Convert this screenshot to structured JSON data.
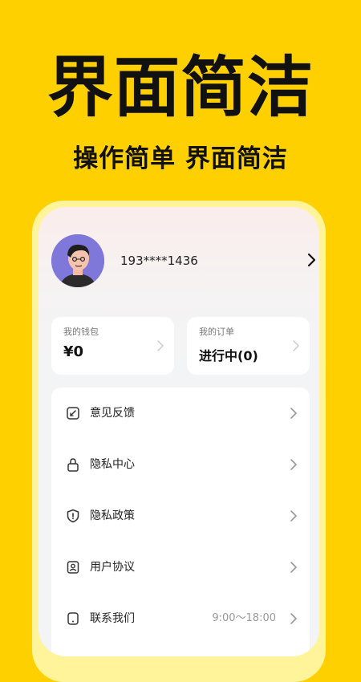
{
  "promo": {
    "title": "界面简洁",
    "subtitle": "操作简单 界面简洁"
  },
  "profile": {
    "phone": "193****1436",
    "avatar_icon": "user-avatar-illustration"
  },
  "cards": [
    {
      "label": "我的钱包",
      "value": "¥0"
    },
    {
      "label": "我的订单",
      "value": "进行中(0)"
    }
  ],
  "menu": [
    {
      "label": "意见反馈",
      "icon": "feedback-icon"
    },
    {
      "label": "隐私中心",
      "icon": "lock-icon"
    },
    {
      "label": "隐私政策",
      "icon": "shield-icon"
    },
    {
      "label": "用户协议",
      "icon": "user-agreement-icon"
    },
    {
      "label": "联系我们",
      "icon": "phone-icon",
      "extra": "9:00～18:00"
    }
  ],
  "colors": {
    "background": "#FFD000",
    "phone_frame": "#FFF49A",
    "text": "#111111"
  }
}
